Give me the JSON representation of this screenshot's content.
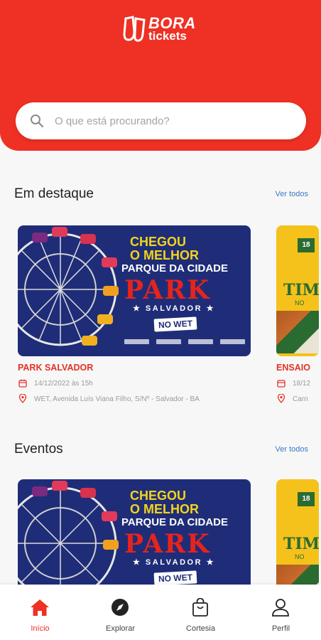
{
  "brand": {
    "line1": "BORA",
    "line2": "tickets"
  },
  "search": {
    "placeholder": "O que está procurando?"
  },
  "sections": {
    "featured": {
      "title": "Em destaque",
      "see_all": "Ver todos"
    },
    "events": {
      "title": "Eventos",
      "see_all": "Ver todos"
    }
  },
  "cards": [
    {
      "name": "PARK SALVADOR",
      "date": "14/12/2022 às 15h",
      "address": "WET, Avenida Luís Viana Filho, S/Nº - Salvador - BA",
      "banner": {
        "line1": "CHEGOU",
        "line1b": "O MELHOR",
        "line2": "PARQUE DA CIDADE",
        "park": "PARK",
        "city": "★ SALVADOR ★",
        "venue": "NO WET"
      }
    },
    {
      "name": "ENSAIO",
      "date": "18/12",
      "address": "Carn",
      "banner": {
        "num": "18",
        "title": "TIM",
        "sub": "NO"
      }
    }
  ],
  "tabs": [
    {
      "label": "Início",
      "icon": "home-icon",
      "active": true
    },
    {
      "label": "Explorar",
      "icon": "compass-icon",
      "active": false
    },
    {
      "label": "Cortesia",
      "icon": "bag-icon",
      "active": false
    },
    {
      "label": "Perfil",
      "icon": "user-icon",
      "active": false
    }
  ],
  "colors": {
    "brand_red": "#ee3124",
    "link_blue": "#3a7bc8",
    "banner_navy": "#1f2d78",
    "banner_yellow": "#f5c21b"
  }
}
